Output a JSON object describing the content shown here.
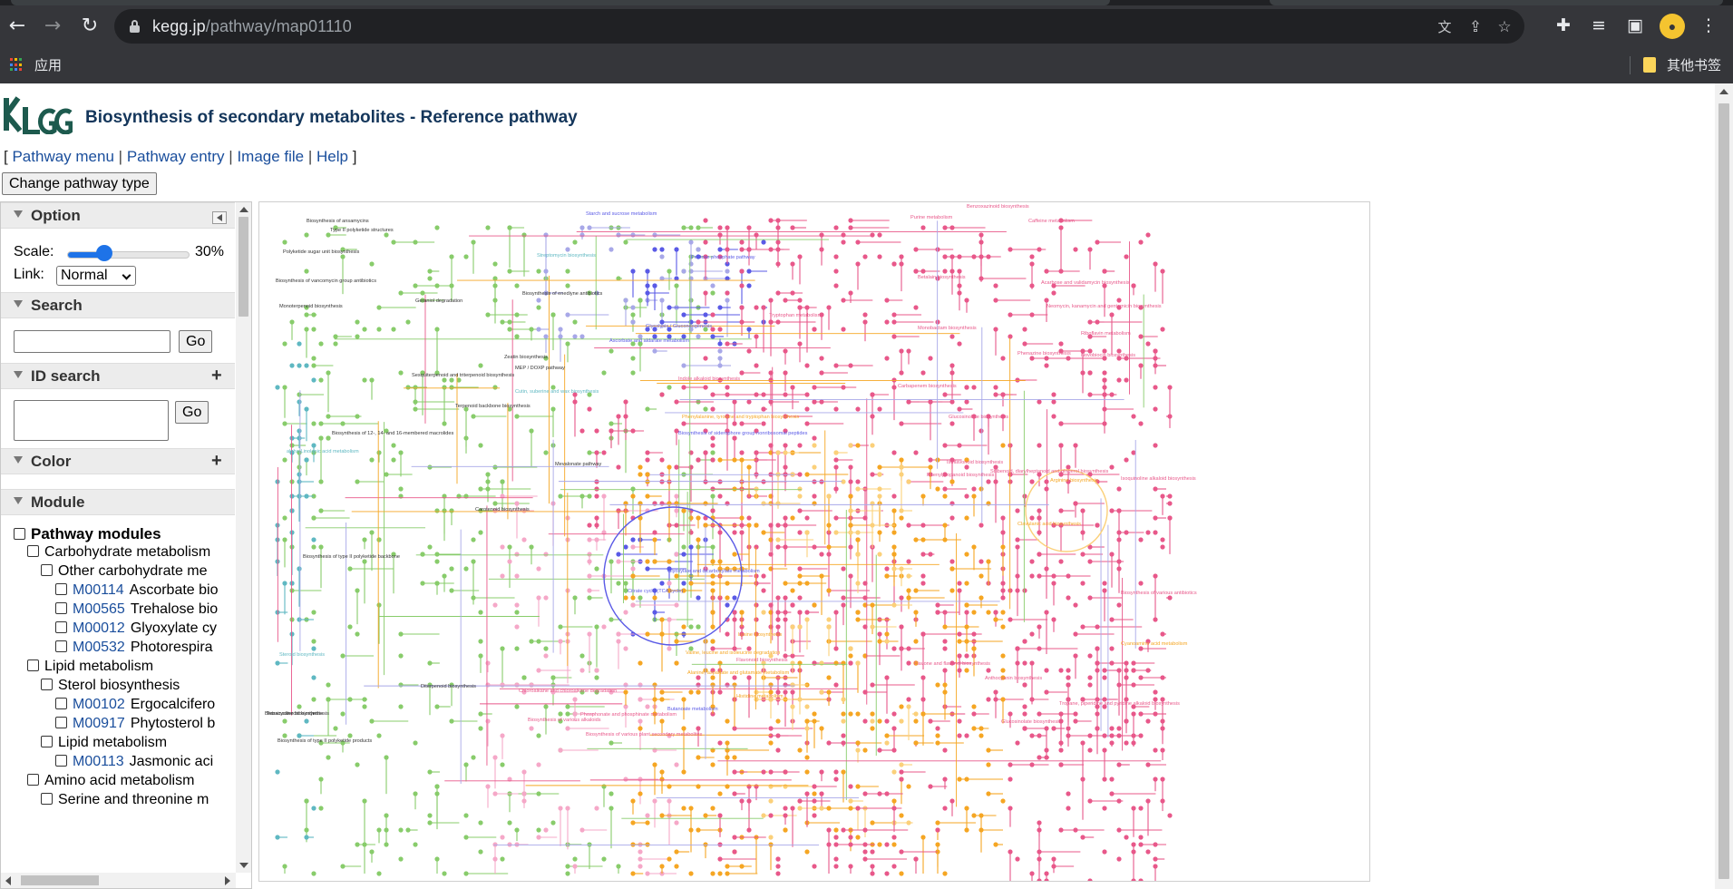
{
  "browser": {
    "url_host": "kegg.jp",
    "url_path": "/pathway/map01110",
    "bookmarks": {
      "apps_label": "应用",
      "other_bookmarks_label": "其他书签"
    }
  },
  "header": {
    "title": "Biosynthesis of secondary metabolites - Reference pathway",
    "bracket_open": "[",
    "bracket_close": "]",
    "separator": "|",
    "links": [
      "Pathway menu",
      "Pathway entry",
      "Image file",
      "Help"
    ],
    "change_button": "Change pathway type"
  },
  "panel": {
    "option": {
      "title": "Option",
      "scale_label": "Scale:",
      "scale_value": "30%",
      "scale_fraction": 0.3,
      "link_label": "Link:",
      "link_value": "Normal"
    },
    "search": {
      "title": "Search",
      "go_label": "Go"
    },
    "id_search": {
      "title": "ID search",
      "go_label": "Go",
      "expand": "+"
    },
    "color": {
      "title": "Color",
      "expand": "+"
    },
    "module": {
      "title": "Module",
      "tree": [
        {
          "level": 0,
          "label": "Pathway modules",
          "bold": true
        },
        {
          "level": 1,
          "label": "Carbohydrate metabolism"
        },
        {
          "level": 2,
          "label": "Other carbohydrate me"
        },
        {
          "level": 3,
          "id": "M00114",
          "label": "Ascorbate bio"
        },
        {
          "level": 3,
          "id": "M00565",
          "label": "Trehalose bio"
        },
        {
          "level": 3,
          "id": "M00012",
          "label": "Glyoxylate cy"
        },
        {
          "level": 3,
          "id": "M00532",
          "label": "Photorespira"
        },
        {
          "level": 1,
          "label": "Lipid metabolism"
        },
        {
          "level": 2,
          "label": "Sterol biosynthesis"
        },
        {
          "level": 3,
          "id": "M00102",
          "label": "Ergocalcifero"
        },
        {
          "level": 3,
          "id": "M00917",
          "label": "Phytosterol b"
        },
        {
          "level": 2,
          "label": "Lipid metabolism"
        },
        {
          "level": 3,
          "id": "M00113",
          "label": "Jasmonic aci"
        },
        {
          "level": 1,
          "label": "Amino acid metabolism"
        },
        {
          "level": 2,
          "label": "Serine and threonine m"
        }
      ]
    }
  },
  "map": {
    "colors": {
      "green": "#88cc6b",
      "teal": "#5fb8c2",
      "lavender": "#a8a8e8",
      "blue": "#5a5ae6",
      "pink": "#e8588a",
      "lightpink": "#f5a8c8",
      "orange": "#f5a623",
      "lightorange": "#fbd07a"
    },
    "labels": [
      {
        "t": "Biosynthesis of ansamycins",
        "c": "green"
      },
      {
        "t": "Type II polyketide structures",
        "c": "green"
      },
      {
        "t": "Polyketide sugar unit biosynthesis",
        "c": "green"
      },
      {
        "t": "Biosynthesis of vancomycin group antibiotics",
        "c": "green"
      },
      {
        "t": "Monoterpenoid biosynthesis",
        "c": "green"
      },
      {
        "t": "Geraniol degradation",
        "c": "green"
      },
      {
        "t": "Biosynthesis of enediyne antibiotics",
        "c": "green"
      },
      {
        "t": "Zeatin biosynthesis",
        "c": "green"
      },
      {
        "t": "Sesquiterpenoid and triterpenoid biosynthesis",
        "c": "green"
      },
      {
        "t": "MEP / DOXP pathway",
        "c": "green"
      },
      {
        "t": "Terpenoid backbone biosynthesis",
        "c": "green"
      },
      {
        "t": "Biosynthesis of 12-, 14- and 16-membered macrolides",
        "c": "green"
      },
      {
        "t": "alpha-Linolenic acid metabolism",
        "c": "teal"
      },
      {
        "t": "Mevalonate pathway",
        "c": "green"
      },
      {
        "t": "Carotenoid biosynthesis",
        "c": "green"
      },
      {
        "t": "Biosynthesis of type II polyketide backbone",
        "c": "green"
      },
      {
        "t": "Steroid biosynthesis",
        "c": "teal"
      },
      {
        "t": "Tetracycline biosynthesis",
        "c": "green"
      },
      {
        "t": "Brassinosteroid biosynthesis",
        "c": "green"
      },
      {
        "t": "Biosynthesis of type II polyketide products",
        "c": "green"
      },
      {
        "t": "Diterpenoid biosynthesis",
        "c": "green"
      },
      {
        "t": "Starch and sucrose metabolism",
        "c": "blue"
      },
      {
        "t": "Streptomycin biosynthesis",
        "c": "teal"
      },
      {
        "t": "Pentose phosphate pathway",
        "c": "blue"
      },
      {
        "t": "Glycolysis / Gluconeogenesis",
        "c": "blue"
      },
      {
        "t": "Ascorbate and aldarate metabolism",
        "c": "blue"
      },
      {
        "t": "Cutin, suberine and wax biosynthesis",
        "c": "teal"
      },
      {
        "t": "Indole alkaloid biosynthesis",
        "c": "pink"
      },
      {
        "t": "Tryptophan metabolism",
        "c": "pink"
      },
      {
        "t": "Phenylalanine, tyrosine and tryptophan biosynthesis",
        "c": "orange"
      },
      {
        "t": "Biosynthesis of siderophore group nonribosomal peptides",
        "c": "blue"
      },
      {
        "t": "Glyoxylate and dicarboxylate metabolism",
        "c": "blue"
      },
      {
        "t": "Citrate cycle (TCA cycle)",
        "c": "blue"
      },
      {
        "t": "Alanine, aspartate and glutamate metabolism",
        "c": "orange"
      },
      {
        "t": "Butanoate metabolism",
        "c": "blue"
      },
      {
        "t": "Phosphonate and phosphinate metabolism",
        "c": "pink"
      },
      {
        "t": "Biosynthesis of various alkaloids",
        "c": "pink"
      },
      {
        "t": "Biosynthesis of various plant secondary metabolites",
        "c": "pink"
      },
      {
        "t": "Purine metabolism",
        "c": "pink"
      },
      {
        "t": "Caffeine metabolism",
        "c": "pink"
      },
      {
        "t": "Benzoxazinoid biosynthesis",
        "c": "pink"
      },
      {
        "t": "Clavulanic acid biosynthesis",
        "c": "orange"
      },
      {
        "t": "Isoquinoline alkaloid biosynthesis",
        "c": "pink"
      },
      {
        "t": "Arginine biosynthesis",
        "c": "orange"
      },
      {
        "t": "Stilbenoid, diarylheptanoid and gingerol biosynthesis",
        "c": "pink"
      },
      {
        "t": "Phenylpropanoid biosynthesis",
        "c": "pink"
      },
      {
        "t": "Flavonoid biosynthesis",
        "c": "pink"
      },
      {
        "t": "Flavone and flavonol biosynthesis",
        "c": "pink"
      },
      {
        "t": "Anthocyanin biosynthesis",
        "c": "pink"
      },
      {
        "t": "Glucosinolate biosynthesis",
        "c": "pink"
      },
      {
        "t": "Tropane, piperidine and pyridine alkaloid biosynthesis",
        "c": "pink"
      },
      {
        "t": "Cyanoamino acid metabolism",
        "c": "orange"
      },
      {
        "t": "Biosynthesis of various antibiotics",
        "c": "pink"
      },
      {
        "t": "Lysine biosynthesis",
        "c": "orange"
      },
      {
        "t": "Valine, leucine and isoleucine degradation",
        "c": "orange"
      },
      {
        "t": "Histidine metabolism",
        "c": "orange"
      },
      {
        "t": "Betalain biosynthesis",
        "c": "pink"
      },
      {
        "t": "Carbapenem biosynthesis",
        "c": "pink"
      },
      {
        "t": "Acarbose and validamycin biosynthesis",
        "c": "pink"
      },
      {
        "t": "Neomycin, kanamycin and gentamicin biosynthesis",
        "c": "pink"
      },
      {
        "t": "Riboflavin metabolism",
        "c": "pink"
      },
      {
        "t": "Novobiocin biosynthesis",
        "c": "pink"
      },
      {
        "t": "Phenazine biosynthesis",
        "c": "pink"
      },
      {
        "t": "Monobactam biosynthesis",
        "c": "pink"
      },
      {
        "t": "Glucosinolate biosynthesis",
        "c": "pink"
      },
      {
        "t": "Isoflavonoid biosynthesis",
        "c": "pink"
      },
      {
        "t": "Chloroalkane and chloroalkene degradation",
        "c": "pink"
      }
    ]
  }
}
